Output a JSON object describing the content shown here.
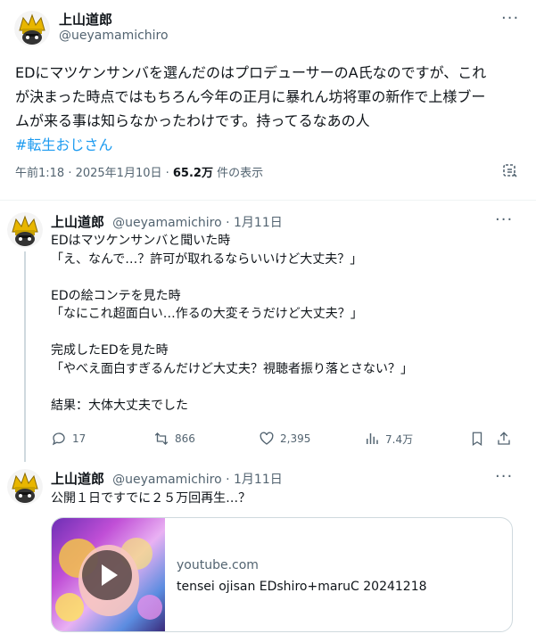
{
  "main_tweet": {
    "author_name": "上山道郎",
    "author_handle": "@ueyamamichiro",
    "lines": [
      "EDにマツケンサンバを選んだのはプロデューサーのA氏なのですが、これ",
      "が決まった時点ではもちろん今年の正月に暴れん坊将軍の新作で上様ブー",
      "ムが来る事は知らなかったわけです。持ってるなあの人"
    ],
    "hashtag": "#転生おじさん",
    "time": "午前1:18 · 2025年1月10日 · ",
    "views_count": "65.2万",
    "views_suffix": " 件の表示"
  },
  "reply1": {
    "author_name": "上山道郎",
    "author_handle": "@ueyamamichiro · 1月11日",
    "lines": [
      "EDはマツケンサンバと聞いた時",
      "「え、なんで…？許可が取れるならいいけど大丈夫？」",
      "",
      "EDの絵コンテを見た時",
      "「なにこれ超面白い…作るの大変そうだけど大丈夫？」",
      "",
      "完成したEDを見た時",
      "「やべえ面白すぎるんだけど大丈夫？視聴者振り落とさない？」",
      "",
      "結果：大体大丈夫でした"
    ],
    "actions": {
      "replies": "17",
      "retweets": "866",
      "likes": "2,395",
      "views": "7.4万"
    }
  },
  "reply2": {
    "author_name": "上山道郎",
    "author_handle": "@ueyamamichiro · 1月11日",
    "text": "公開１日ですでに２５万回再生…？",
    "card": {
      "domain": "youtube.com",
      "title": "tensei ojisan EDshiro+maruC 20241218"
    }
  },
  "icons": [
    "avatar",
    "more-icon",
    "bookmark-icon",
    "share-icon",
    "reply-icon",
    "retweet-icon",
    "like-icon",
    "views-icon",
    "play-icon",
    "grok-icon"
  ]
}
